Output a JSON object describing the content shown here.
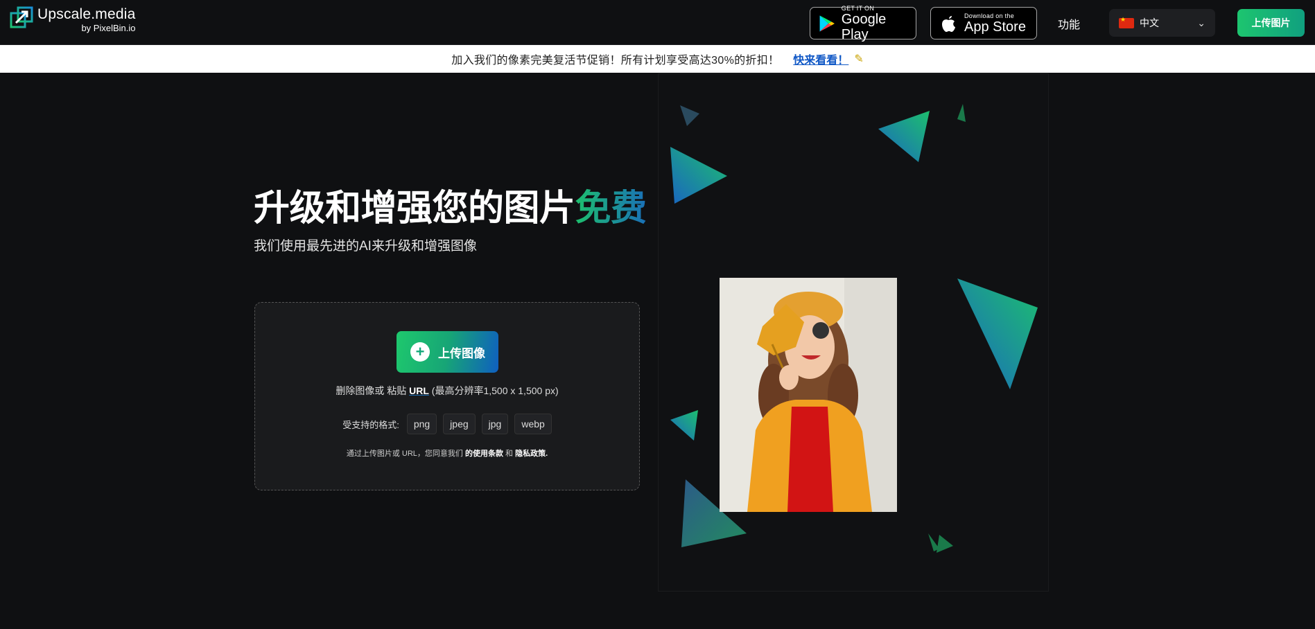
{
  "header": {
    "logo_name": "Upscale.media",
    "logo_by": "by PixelBin.io",
    "google_play": {
      "small": "GET IT ON",
      "big": "Google Play"
    },
    "app_store": {
      "small": "Download on the",
      "big": "App Store"
    },
    "nav_features": "功能",
    "language": "中文",
    "upload_button": "上传图片"
  },
  "promo": {
    "text": "加入我们的像素完美复活节促销！所有计划享受高达30%的折扣！",
    "link": "快来看看！"
  },
  "hero": {
    "title_main": "升级和增强您的图片",
    "title_accent": "免费",
    "subtitle": "我们使用最先进的AI来升级和增强图像"
  },
  "upload_box": {
    "button_label": "上传图像",
    "hint_prefix": "删除图像或 粘贴",
    "hint_url": "URL",
    "hint_suffix": "(最高分辨率1,500 x 1,500 px)",
    "formats_label": "受支持的格式:",
    "formats": [
      "png",
      "jpeg",
      "jpg",
      "webp"
    ],
    "terms_prefix": "通过上传图片或 URL，您同意我们",
    "terms_link": "的使用条款",
    "terms_and": "和",
    "privacy_link": "隐私政策."
  },
  "colors": {
    "brand_green": "#1dc56f",
    "brand_blue": "#0f5fc0",
    "background": "#0f1012"
  }
}
